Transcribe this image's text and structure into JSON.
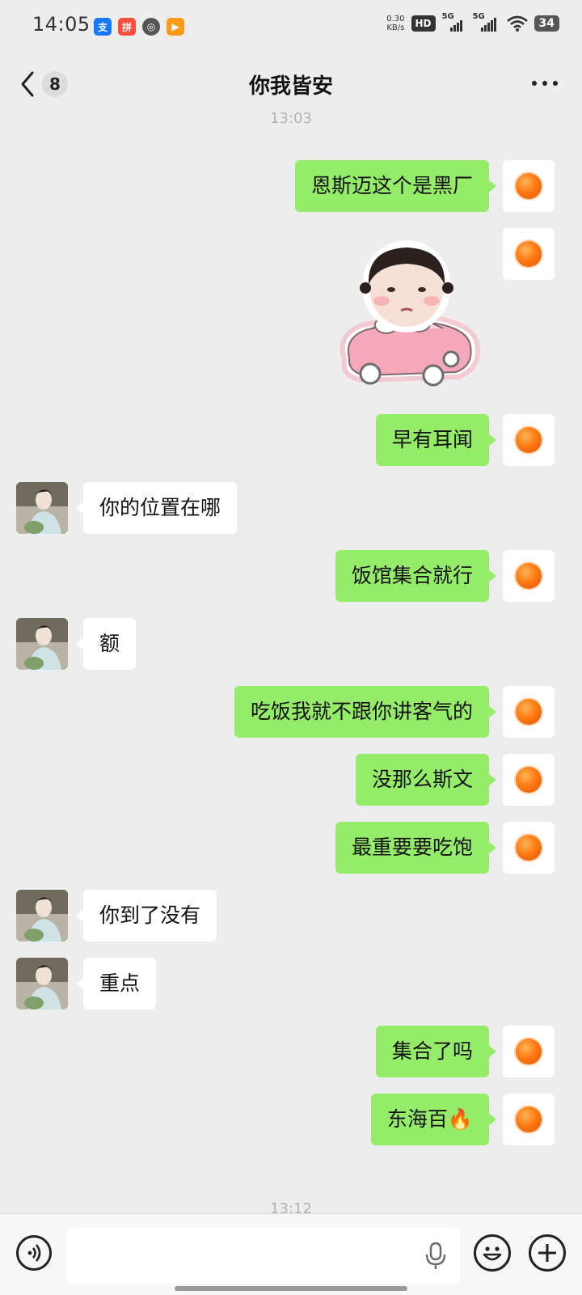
{
  "status_bar": {
    "time": "14:05",
    "net_speed_value": "0.30",
    "net_speed_unit": "KB/s",
    "hd_label": "HD",
    "sim1": "5G",
    "sim2": "5G",
    "battery": "34"
  },
  "header": {
    "back_icon": "chevron-left-icon",
    "unread_count": "8",
    "title": "你我皆安",
    "more_icon": "more-dots-icon"
  },
  "timestamps": [
    "13:03",
    "13:12"
  ],
  "messages": [
    {
      "from": "me",
      "text": "恩斯迈这个是黑厂"
    },
    {
      "from": "me",
      "type": "sticker",
      "sticker": "baby-in-pink-car-sticker"
    },
    {
      "from": "me",
      "text": "早有耳闻"
    },
    {
      "from": "other",
      "text": "你的位置在哪"
    },
    {
      "from": "me",
      "text": "饭馆集合就行"
    },
    {
      "from": "other",
      "text": "额"
    },
    {
      "from": "me",
      "text": "吃饭我就不跟你讲客气的"
    },
    {
      "from": "me",
      "text": "没那么斯文"
    },
    {
      "from": "me",
      "text": "最重要要吃饱"
    },
    {
      "from": "other",
      "text": "你到了没有"
    },
    {
      "from": "other",
      "text": "重点"
    },
    {
      "from": "me",
      "text": "集合了吗"
    },
    {
      "from": "me",
      "text": "东海百🔥"
    }
  ],
  "input_bar": {
    "voice_icon": "voice-toggle-icon",
    "mic_icon": "microphone-icon",
    "emoji_icon": "emoji-icon",
    "plus_icon": "plus-icon"
  },
  "colors": {
    "my_bubble": "#95ec69",
    "their_bubble": "#ffffff",
    "background": "#ededed"
  }
}
